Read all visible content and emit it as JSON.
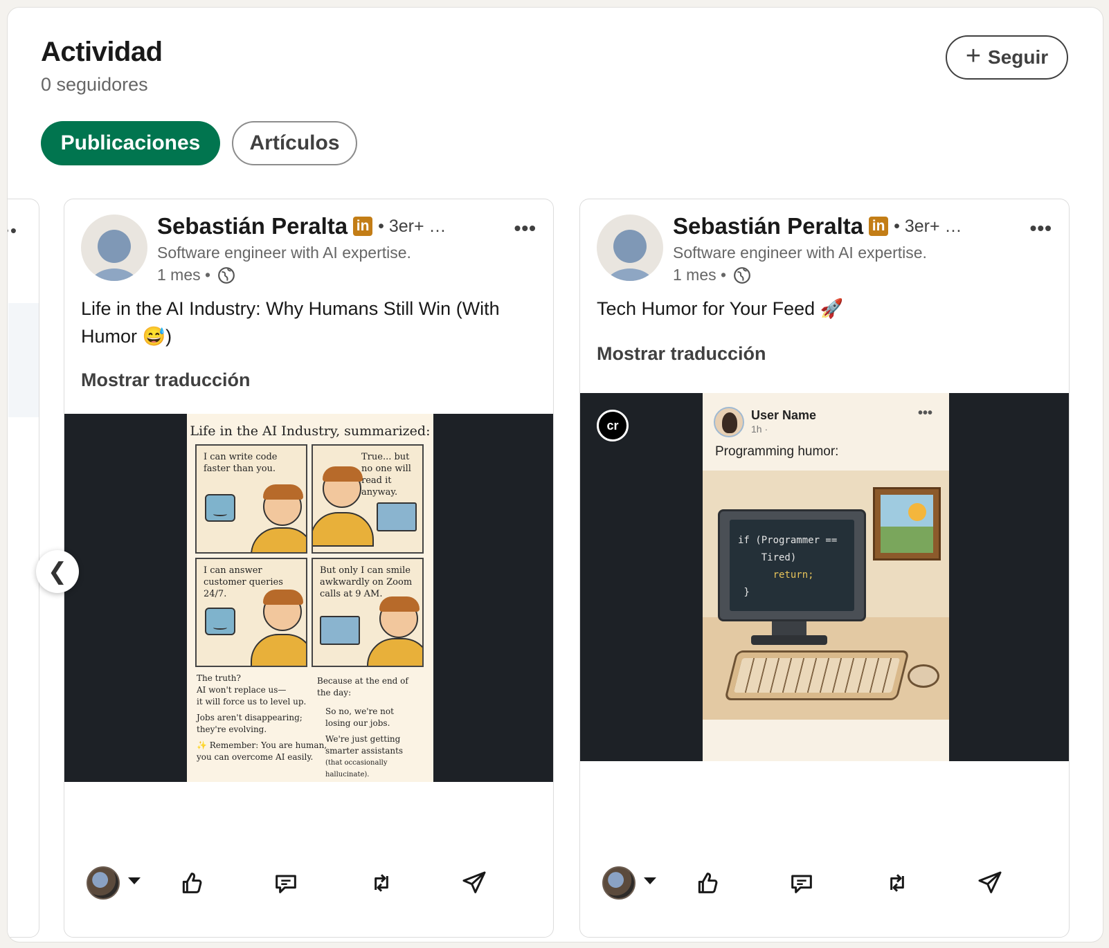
{
  "section": {
    "title": "Actividad",
    "followers": "0 seguidores",
    "follow_button": "Seguir"
  },
  "tabs": [
    {
      "label": "Publicaciones",
      "active": true
    },
    {
      "label": "Artículos",
      "active": false
    }
  ],
  "colors": {
    "accent_green": "#01754f",
    "linkedin_badge": "#c37d16"
  },
  "posts": [
    {
      "author": "Sebastián Peralta",
      "badge": "in",
      "degree": "• 3er+ …",
      "headline": "Software engineer with AI expertise.",
      "time": "1 mes •",
      "text": "Life in the AI Industry: Why Humans Still Win (With Humor 😅)",
      "translate": "Mostrar traducción",
      "image": {
        "title": "Life in the AI Industry, summarized:",
        "panels": [
          "I can write code faster than you.",
          "True... but no one will read it anyway.",
          "I can answer customer queries 24/7.",
          "But only I can smile awkwardly on Zoom calls at 9 AM."
        ],
        "footer_left": [
          "The truth?",
          "AI won't replace us—",
          "it will force us to level up.",
          "Jobs aren't disappearing;",
          "they're evolving.",
          "✨ Remember: You are human,",
          "you can overcome AI easily."
        ],
        "footer_right": [
          "Because at the end of",
          "the day:",
          "So no, we're not",
          "losing our jobs.",
          "We're just getting",
          "smarter assistants",
          "(that occasionally hallucinate)."
        ]
      }
    },
    {
      "author": "Sebastián Peralta",
      "badge": "in",
      "degree": "• 3er+ …",
      "headline": "Software engineer with AI expertise.",
      "time": "1 mes •",
      "text": "Tech Humor for Your Feed 🚀",
      "translate": "Mostrar traducción",
      "image": {
        "badge": "cr",
        "user_name": "User Name",
        "user_time": "1h ·",
        "post_text": "Programming humor:",
        "code_line1": "if (Programmer ==",
        "code_line2": "    Tired)",
        "code_line3": "      return;",
        "code_line4": " }"
      }
    }
  ],
  "icons": {
    "more": "more-horizontal-icon",
    "globe": "globe-icon",
    "like": "like-icon",
    "comment": "comment-icon",
    "repost": "repost-icon",
    "send": "send-icon",
    "prev": "chevron-left-icon"
  },
  "nav": {
    "prev": "❮"
  }
}
